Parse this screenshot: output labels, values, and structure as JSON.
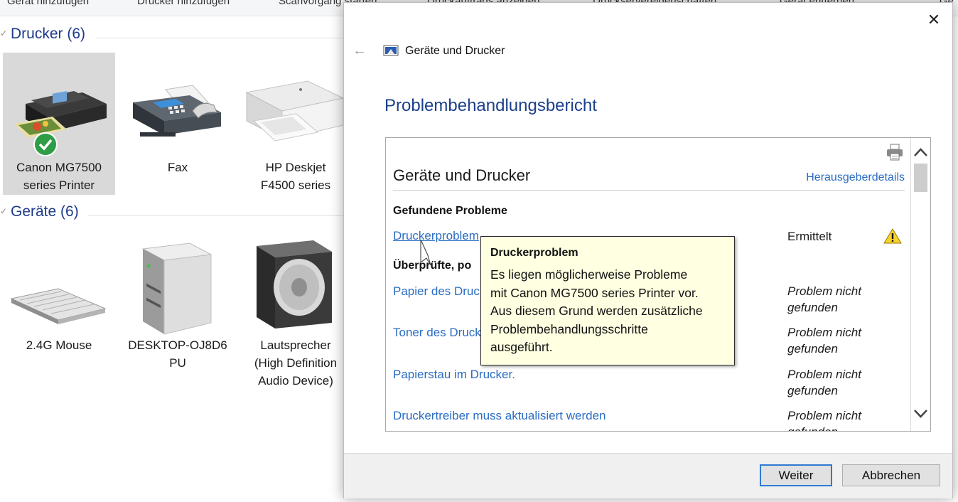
{
  "command_bar": {
    "items": [
      "Gerät hinzufügen",
      "Drucker hinzufügen",
      "Scanvorgang starten",
      "Druckauftrags anzeigen",
      "Druckservereigenschaften",
      "Gerät entfernen",
      "Ge"
    ]
  },
  "groups": {
    "printers": {
      "title": "Drucker (6)",
      "items": [
        {
          "label_line1": "Canon MG7500",
          "label_line2": "series Printer",
          "icon": "multifunction-printer-icon",
          "selected": true,
          "default": true
        },
        {
          "label_line1": "Fax",
          "label_line2": "",
          "icon": "fax-icon"
        },
        {
          "label_line1": "HP Deskjet",
          "label_line2": "F4500 series",
          "icon": "printer-icon"
        }
      ]
    },
    "devices": {
      "title": "Geräte (6)",
      "items": [
        {
          "label_line1": "2.4G Mouse",
          "label_line2": "",
          "label_line3": "",
          "icon": "keyboard-icon"
        },
        {
          "label_line1": "DESKTOP-OJ8D6",
          "label_line2": "PU",
          "label_line3": "",
          "icon": "computer-tower-icon"
        },
        {
          "label_line1": "Lautsprecher",
          "label_line2": "(High Definition",
          "label_line3": "Audio Device)",
          "icon": "speaker-icon"
        }
      ]
    }
  },
  "dialog": {
    "app_title": "Geräte und Drucker",
    "heading": "Problembehandlungsbericht",
    "report": {
      "title": "Geräte und Drucker",
      "publisher_link": "Herausgeberdetails",
      "found_section": "Gefundene Probleme",
      "found": [
        {
          "label": "Druckerproblem",
          "status": "Ermittelt"
        }
      ],
      "checked_section": "Überprüfte, po",
      "checked": [
        {
          "label": "Papier des Druc",
          "status_line1": "Problem nicht",
          "status_line2": "gefunden"
        },
        {
          "label": "Toner des Druck",
          "status_line1": "Problem nicht",
          "status_line2": "gefunden"
        },
        {
          "label": "Papierstau im Drucker.",
          "status_line1": "Problem nicht",
          "status_line2": "gefunden"
        },
        {
          "label": "Druckertreiber muss aktualisiert werden",
          "status_line1": "Problem nicht",
          "status_line2": "gefunden"
        }
      ]
    },
    "buttons": {
      "next": "Weiter",
      "cancel": "Abbrechen"
    }
  },
  "tooltip": {
    "title": "Druckerproblem",
    "body": "Es liegen möglicherweise Probleme\nmit Canon MG7500 series Printer vor.\nAus diesem Grund werden zusätzliche\nProblembehandlungsschritte\nausgeführt."
  },
  "colors": {
    "link": "#2a6cc2",
    "heading": "#1c3f8c",
    "group_title": "#1e3a8a",
    "tooltip_bg": "#ffffe1",
    "primary_border": "#2f7bd3"
  }
}
